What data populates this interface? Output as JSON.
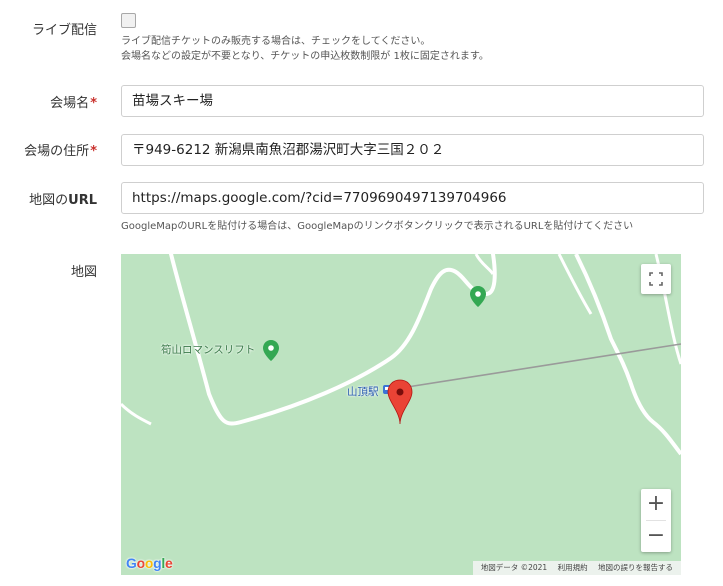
{
  "live": {
    "label": "ライブ配信",
    "checked": false,
    "help_line1": "ライブ配信チケットのみ販売する場合は、チェックをしてください。",
    "help_line2": "会場名などの設定が不要となり、チケットの申込枚数制限が 1枚に固定されます。"
  },
  "venue": {
    "label": "会場名",
    "required_mark": "*",
    "value": "苗場スキー場"
  },
  "address": {
    "label": "会場の住所",
    "required_mark": "*",
    "value": "〒949-6212 新潟県南魚沼郡湯沢町大字三国２０２"
  },
  "map_url": {
    "label_prefix": "地図の",
    "label_suffix": "URL",
    "value": "https://maps.google.com/?cid=7709690497139704966",
    "help": "GoogleMapのURLを貼付ける場合は、GoogleMapのリンクボタンクリックで表示されるURLを貼付けてください"
  },
  "map": {
    "label": "地図",
    "poi_label": "筍山ロマンスリフト",
    "station_label": "山頂駅",
    "zoom_in": "+",
    "zoom_out": "−",
    "logo": "Google",
    "attribution": [
      "地図データ ©2021",
      "利用規約",
      "地図の誤りを報告する"
    ],
    "colors": {
      "land": "#bde3c1",
      "road": "#ffffff",
      "poi_pin": "#34a853",
      "marker": "#ea4335"
    },
    "icons": [
      "fullscreen-icon",
      "poi-pin-icon",
      "location-marker-icon",
      "train-station-icon"
    ]
  }
}
